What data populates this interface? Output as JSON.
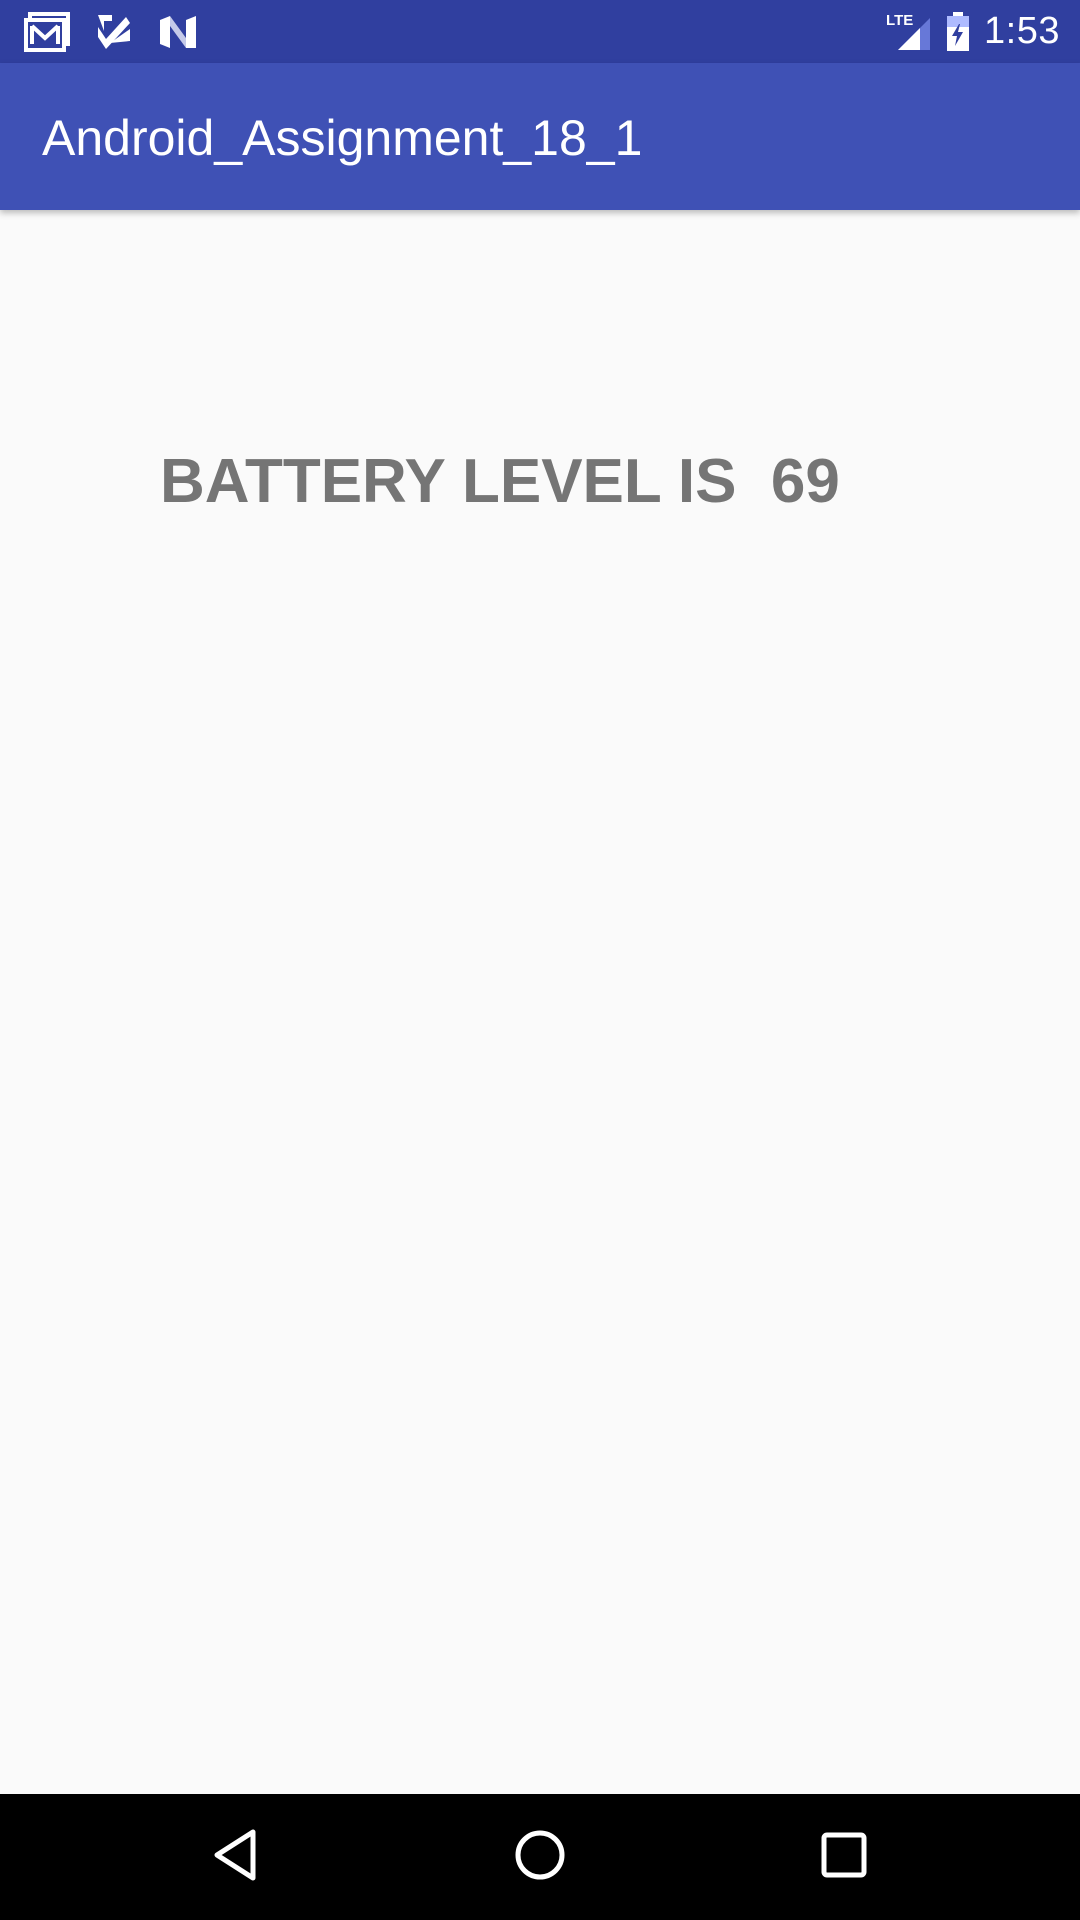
{
  "status_bar": {
    "time": "1:53",
    "network_label": "LTE",
    "left_icons": [
      "gmail-icon",
      "checkmark-app-icon",
      "n-logo-icon"
    ],
    "right_icons": [
      "lte-signal-icon",
      "battery-charging-icon"
    ],
    "background_color": "#303F9F"
  },
  "app_bar": {
    "title": "Android_Assignment_18_1",
    "background_color": "#3F51B5"
  },
  "main": {
    "battery_text": "BATTERY LEVEL IS  69",
    "text_color": "#757575",
    "background_color": "#FAFAFA"
  },
  "nav_bar": {
    "buttons": [
      "back-icon",
      "home-icon",
      "recents-icon"
    ]
  }
}
